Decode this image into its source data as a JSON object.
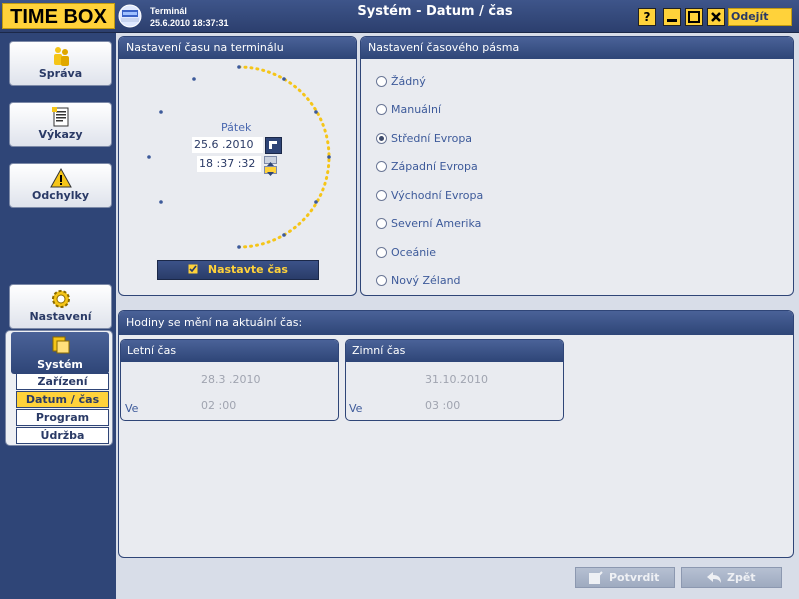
{
  "app": {
    "brand": "TIME BOX",
    "terminal_label": "Terminál",
    "terminal_datetime": "25.6.2010 18:37:31",
    "window_title": "Systém - Datum / čas",
    "help_label": "?",
    "exit_label": "Odejít"
  },
  "sidebar": {
    "items": [
      {
        "label": "Správa",
        "icon": "users-icon"
      },
      {
        "label": "Výkazy",
        "icon": "report-icon"
      },
      {
        "label": "Odchylky",
        "icon": "warning-icon"
      },
      {
        "label": "Nastavení",
        "icon": "gear-icon"
      }
    ],
    "system": {
      "label": "Systém",
      "icon": "system-icon",
      "subitems": [
        "Zařízení",
        "Datum / čas",
        "Program",
        "Údržba"
      ],
      "selected": "Datum / čas"
    }
  },
  "time_panel": {
    "title": "Nastavení času na terminálu",
    "day": "Pátek",
    "date": "25.6 .2010",
    "time": "18 :37 :32",
    "set_button": "Nastavte čas"
  },
  "tz_panel": {
    "title": "Nastavení časového pásma",
    "options": [
      "Žádný",
      "Manuální",
      "Střední Evropa",
      "Západní Evropa",
      "Východní Evropa",
      "Severní Amerika",
      "Oceánie",
      "Nový Zéland"
    ],
    "selected": "Střední Evropa"
  },
  "dst_panel": {
    "title": "Hodiny se mění na aktuální čas:",
    "summer": {
      "title": "Letní čas",
      "date": "28.3 .2010",
      "ve_label": "Ve",
      "time": "02 :00"
    },
    "winter": {
      "title": "Zimní čas",
      "date": "31.10.2010",
      "ve_label": "Ve",
      "time": "03 :00"
    }
  },
  "footer": {
    "confirm": "Potvrdit",
    "back": "Zpět"
  },
  "colors": {
    "accent": "#ffd23a",
    "navy": "#2f4577",
    "panel": "#e9ebf0"
  }
}
